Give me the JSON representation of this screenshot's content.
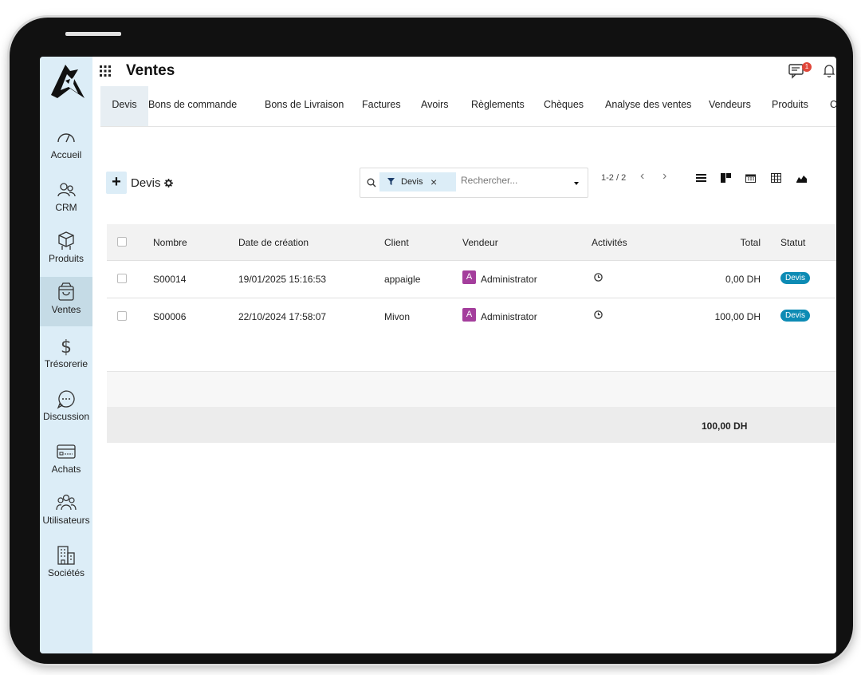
{
  "app": {
    "title": "Ventes"
  },
  "notifications": {
    "chat_count": "1"
  },
  "sidebar": {
    "items": [
      {
        "label": "Accueil",
        "icon": "gauge-icon"
      },
      {
        "label": "CRM",
        "icon": "users-icon"
      },
      {
        "label": "Produits",
        "icon": "boxes-icon"
      },
      {
        "label": "Ventes",
        "icon": "shopping-bag-icon",
        "active": true
      },
      {
        "label": "Trésorerie",
        "icon": "dollar-icon"
      },
      {
        "label": "Discussion",
        "icon": "chat-bubble-icon"
      },
      {
        "label": "Achats",
        "icon": "credit-card-icon"
      },
      {
        "label": "Utilisateurs",
        "icon": "user-group-icon"
      },
      {
        "label": "Sociétés",
        "icon": "building-icon"
      }
    ]
  },
  "tabs": [
    "Devis",
    "Bons de commande",
    "Bons de Livraison",
    "Factures",
    "Avoirs",
    "Règlements",
    "Chèques",
    "Analyse des ventes",
    "Vendeurs",
    "Produits",
    "C"
  ],
  "control_panel": {
    "new_label": "+",
    "breadcrumb": "Devis",
    "search": {
      "facet_label": "Devis",
      "facet_remove": "×",
      "placeholder": "Rechercher..."
    },
    "pager": {
      "value": "1-2 / 2",
      "prev": "‹",
      "next": "›"
    },
    "views": [
      "list-view-icon",
      "kanban-view-icon",
      "calendar-view-icon",
      "pivot-view-icon",
      "graph-view-icon"
    ]
  },
  "table": {
    "columns": [
      "Nombre",
      "Date de création",
      "Client",
      "Vendeur",
      "Activités",
      "Total",
      "Statut"
    ],
    "rows": [
      {
        "number": "S00014",
        "date": "19/01/2025 15:16:53",
        "client": "appaigle",
        "avatar": "A",
        "vendor": "Administrator",
        "total": "0,00 DH",
        "status": "Devis"
      },
      {
        "number": "S00006",
        "date": "22/10/2024 17:58:07",
        "client": "Mivon",
        "avatar": "A",
        "vendor": "Administrator",
        "total": "100,00 DH",
        "status": "Devis"
      }
    ],
    "footer_total": "100,00 DH"
  },
  "colors": {
    "sidebar_bg": "#dcedf7",
    "status_badge": "#0d8bb4",
    "avatar_bg": "#a43e9c",
    "notification_badge": "#e0473a"
  }
}
